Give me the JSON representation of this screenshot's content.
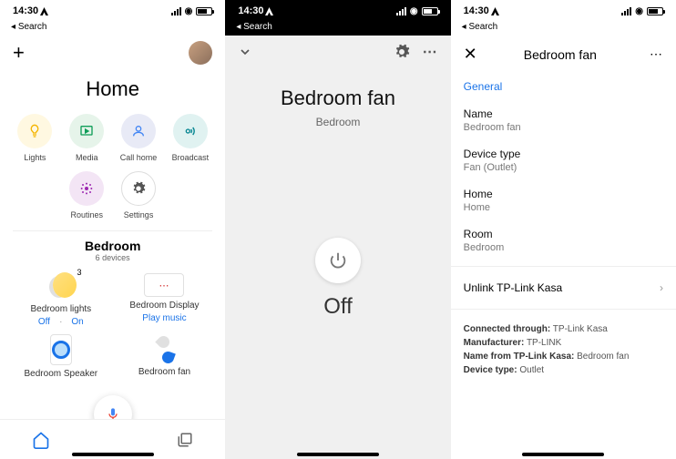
{
  "status": {
    "time": "14:30",
    "back": "Search"
  },
  "p1": {
    "title": "Home",
    "actions": [
      {
        "label": "Lights",
        "cls": "c-yellow"
      },
      {
        "label": "Media",
        "cls": "c-green"
      },
      {
        "label": "Call home",
        "cls": "c-blue"
      },
      {
        "label": "Broadcast",
        "cls": "c-teal"
      },
      {
        "label": "Routines",
        "cls": "c-purple"
      },
      {
        "label": "Settings",
        "cls": "c-grey"
      }
    ],
    "room": {
      "name": "Bedroom",
      "sub": "6 devices"
    },
    "devices": {
      "lights": {
        "name": "Bedroom lights",
        "badge": "3",
        "off": "Off",
        "on": "On"
      },
      "display": {
        "name": "Bedroom Display",
        "action": "Play music"
      },
      "speaker": {
        "name": "Bedroom Speaker"
      },
      "fan": {
        "name": "Bedroom fan"
      }
    }
  },
  "p2": {
    "title": "Bedroom fan",
    "sub": "Bedroom",
    "state": "Off"
  },
  "p3": {
    "title": "Bedroom fan",
    "tab": "General",
    "fields": [
      {
        "label": "Name",
        "val": "Bedroom fan"
      },
      {
        "label": "Device type",
        "val": "Fan (Outlet)"
      },
      {
        "label": "Home",
        "val": "Home"
      },
      {
        "label": "Room",
        "val": "Bedroom"
      }
    ],
    "unlink": "Unlink TP-Link Kasa",
    "meta": [
      {
        "k": "Connected through:",
        "v": "TP-Link Kasa"
      },
      {
        "k": "Manufacturer:",
        "v": "TP-LINK"
      },
      {
        "k": "Name from TP-Link Kasa:",
        "v": "Bedroom fan"
      },
      {
        "k": "Device type:",
        "v": "Outlet"
      }
    ]
  }
}
